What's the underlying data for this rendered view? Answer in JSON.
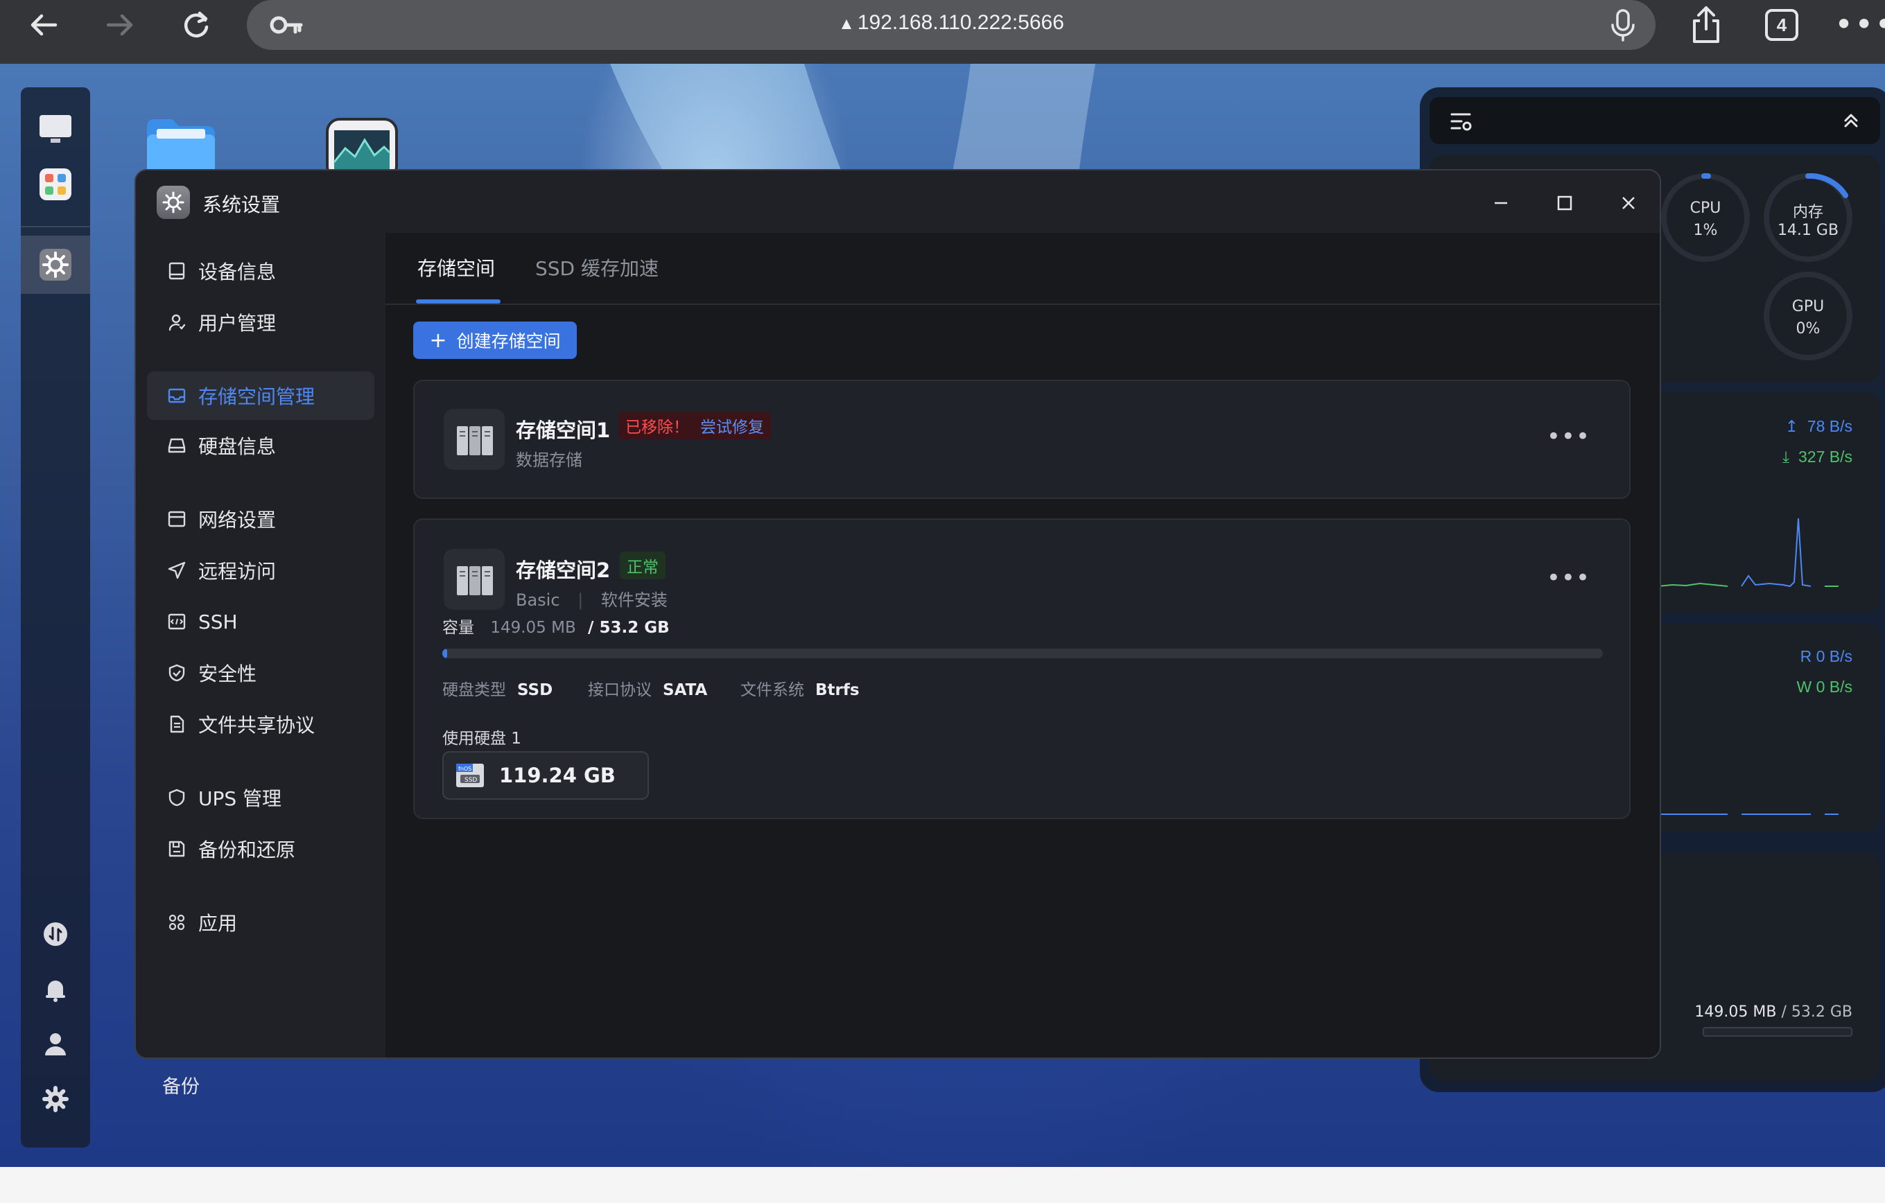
{
  "browser": {
    "url": "192.168.110.222:5666",
    "warning_glyph": "▲",
    "tab_count": "4",
    "more_glyph": "•••"
  },
  "window": {
    "title": "系统设置",
    "sidebar": {
      "items": [
        {
          "label": "设备信息",
          "icon": "monitor-icon"
        },
        {
          "label": "用户管理",
          "icon": "user-icon"
        },
        {
          "label": "存储空间管理",
          "icon": "storage-icon",
          "active": true
        },
        {
          "label": "硬盘信息",
          "icon": "disk-icon"
        },
        {
          "label": "网络设置",
          "icon": "network-icon"
        },
        {
          "label": "远程访问",
          "icon": "send-icon"
        },
        {
          "label": "SSH",
          "icon": "terminal-icon"
        },
        {
          "label": "安全性",
          "icon": "shield-check-icon"
        },
        {
          "label": "文件共享协议",
          "icon": "document-icon"
        },
        {
          "label": "UPS 管理",
          "icon": "shield-icon"
        },
        {
          "label": "备份和还原",
          "icon": "backup-icon"
        },
        {
          "label": "应用",
          "icon": "apps-icon"
        }
      ]
    },
    "tabs": [
      {
        "label": "存储空间",
        "active": true
      },
      {
        "label": "SSD 缓存加速",
        "active": false
      }
    ],
    "create_button": {
      "plus": "+",
      "label": "创建存储空间"
    },
    "pools": [
      {
        "name": "存储空间1",
        "status": "已移除！",
        "repair_link": "尝试修复",
        "subtitle": "数据存储"
      },
      {
        "name": "存储空间2",
        "status": "正常",
        "mode": "Basic",
        "subtitle": "软件安装",
        "capacity_label": "容量",
        "used": "149.05 MB",
        "total": "/ 53.2 GB",
        "usage_fraction": 0.003,
        "disk_type_label": "硬盘类型",
        "disk_type": "SSD",
        "interface_label": "接口协议",
        "interface": "SATA",
        "fs_label": "文件系统",
        "fs": "Btrfs",
        "disks_label": "使用硬盘 1",
        "disk_size": "119.24 GB"
      }
    ]
  },
  "widgets": {
    "cpu_label": "CPU",
    "cpu_value": "1%",
    "mem_label": "内存",
    "mem_value": "14.1 GB",
    "gpu_label": "GPU",
    "gpu_value": "0%",
    "net_up": "78 B/s",
    "net_down": "327 B/s",
    "disk_read": "R  0 B/s",
    "disk_write": "W  0 B/s",
    "storage_used": "149.05 MB",
    "storage_total": "/ 53.2 GB"
  },
  "desktop": {
    "backup_label": "备份"
  },
  "colors": {
    "accent": "#3f7de8",
    "danger": "#ff4d4f",
    "success": "#4fc26b"
  }
}
